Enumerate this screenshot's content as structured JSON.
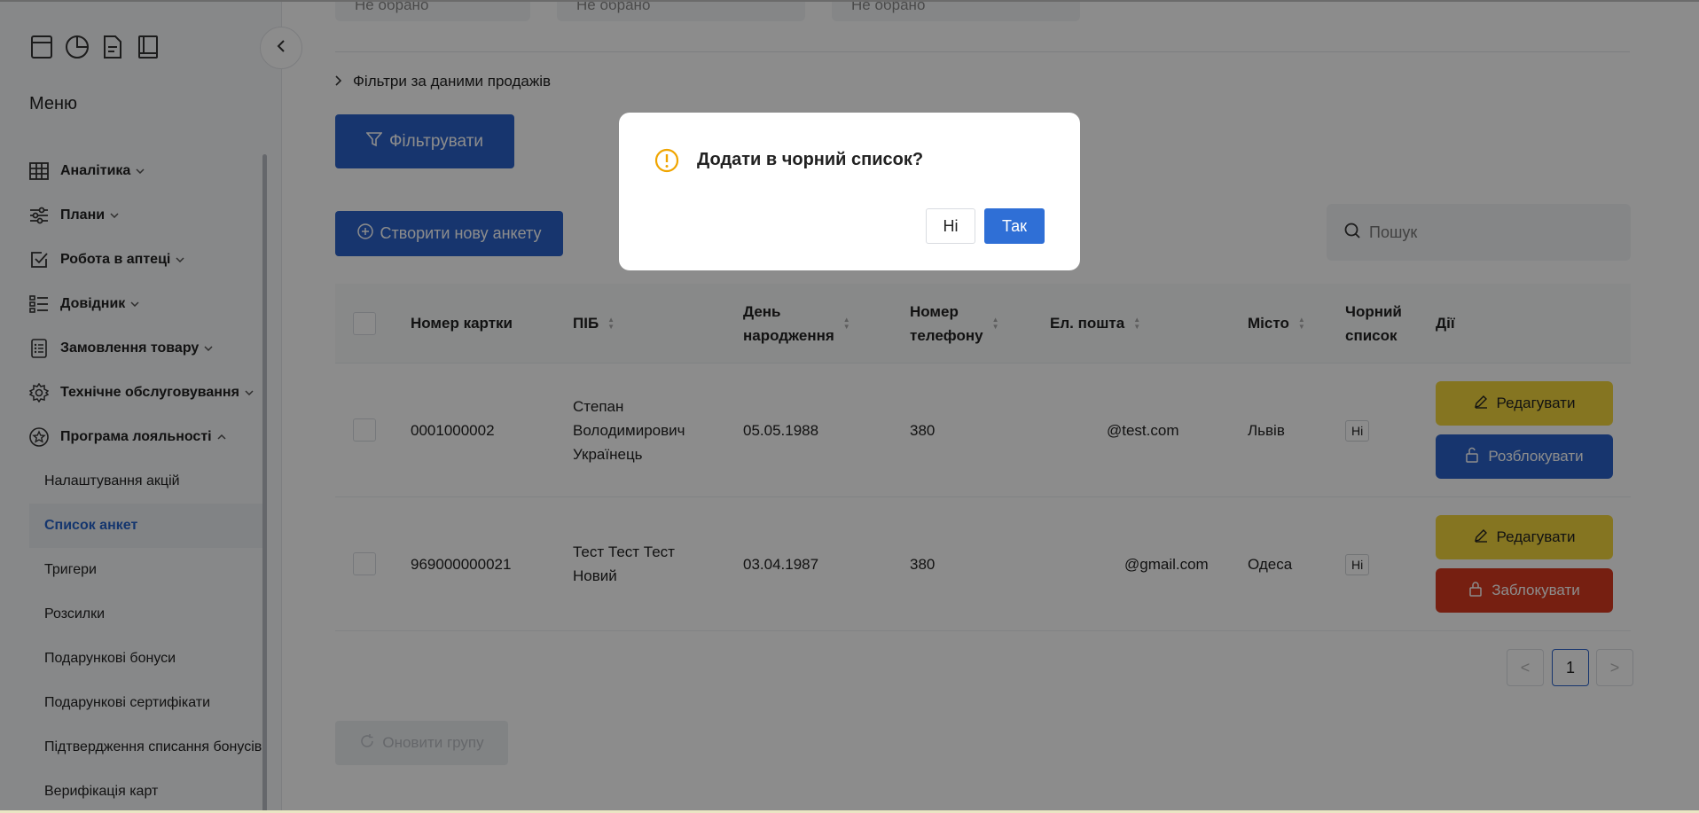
{
  "sidebar": {
    "menu_title": "Меню",
    "items": [
      {
        "label": "Аналітика",
        "icon": "table-icon"
      },
      {
        "label": "Плани",
        "icon": "sliders-icon"
      },
      {
        "label": "Робота в аптеці",
        "icon": "checkbox-icon"
      },
      {
        "label": "Довідник",
        "icon": "list-icon"
      },
      {
        "label": "Замовлення товару",
        "icon": "clipboard-icon"
      },
      {
        "label": "Технічне обслуговування",
        "icon": "gear-icon"
      },
      {
        "label": "Програма лояльності",
        "icon": "star-icon"
      }
    ],
    "sub_items": [
      "Налаштування акцій",
      "Список анкет",
      "Тригери",
      "Розсилки",
      "Подарункові бонуси",
      "Подарункові сертифікати",
      "Підтвердження списання бонусів",
      "Верифікація карт"
    ]
  },
  "filters": {
    "selects": [
      "Не обрано",
      "Не обрано",
      "Не обрано"
    ],
    "sales_filter_label": "Фільтри за даними продажів",
    "filter_button": "Фільтрувати"
  },
  "toolbar": {
    "create_button": "Створити нову анкету",
    "search_placeholder": "Пошук"
  },
  "table": {
    "headers": {
      "card": "Номер картки",
      "name": "ПІБ",
      "birthday_1": "День",
      "birthday_2": "народження",
      "phone_1": "Номер",
      "phone_2": "телефону",
      "email": "Ел. пошта",
      "city": "Місто",
      "blacklist_1": "Чорний",
      "blacklist_2": "список",
      "actions": "Дії"
    },
    "rows": [
      {
        "card": "0001000002",
        "name_1": "Степан",
        "name_2": "Володимирович",
        "name_3": "Українець",
        "birthday": "05.05.1988",
        "phone": "380",
        "email": "@test.com",
        "city": "Львів",
        "blacklist": "Ні",
        "edit": "Редагувати",
        "toggle": "Розблокувати"
      },
      {
        "card": "969000000021",
        "name_1": "Тест Тест Тест",
        "name_2": "Новий",
        "birthday": "03.04.1987",
        "phone": "380",
        "email": "@gmail.com",
        "city": "Одеса",
        "blacklist": "Ні",
        "edit": "Редагувати",
        "toggle": "Заблокувати"
      }
    ]
  },
  "pagination": {
    "prev": "<",
    "current": "1",
    "next": ">"
  },
  "refresh_button": "Оновити групу",
  "modal": {
    "title": "Додати в чорний список?",
    "no": "Ні",
    "yes": "Так"
  },
  "colors": {
    "primary": "#2a62c9",
    "edit": "#f3d63c",
    "block": "#d8391f",
    "warning": "#f0a500"
  }
}
